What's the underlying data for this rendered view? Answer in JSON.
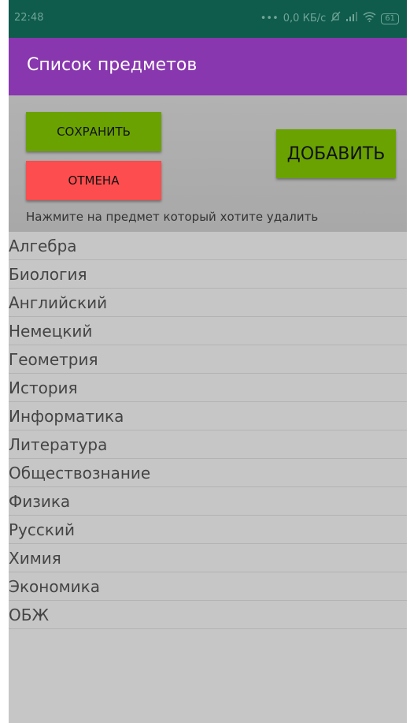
{
  "status_bar": {
    "time": "22:48",
    "network_speed": "0,0 КБ/с",
    "battery": "61",
    "icons": [
      "dots-icon",
      "alarm-off-icon",
      "signal-icon",
      "wifi-icon",
      "battery-icon"
    ]
  },
  "app_bar": {
    "title": "Список предметов",
    "color": "#8837ae"
  },
  "controls": {
    "save_label": "СОХРАНИТЬ",
    "cancel_label": "ОТМЕНА",
    "add_label": "ДОБАВИТЬ",
    "hint": "Нажмите на предмет который хотите удалить"
  },
  "colors": {
    "accent_green": "#6aa202",
    "cancel_red": "#fd4d4e",
    "status_bar": "#0f5b4c",
    "background": "#c6c6c6"
  },
  "subjects": [
    "Алгебра",
    "Биология",
    "Английский",
    "Немецкий",
    "Геометрия",
    "История",
    "Информатика",
    "Литература",
    "Обществознание",
    "Физика",
    "Русский",
    "Химия",
    "Экономика",
    "ОБЖ"
  ]
}
